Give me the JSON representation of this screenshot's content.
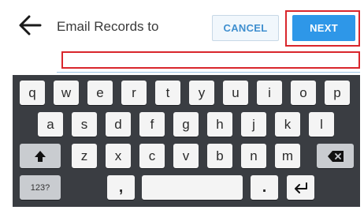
{
  "header": {
    "back_icon": "arrow-left-icon",
    "title": "Email Records to",
    "cancel_label": "CANCEL",
    "next_label": "NEXT"
  },
  "email_input": {
    "value": "",
    "placeholder": ""
  },
  "keyboard": {
    "row1": [
      "q",
      "w",
      "e",
      "r",
      "t",
      "y",
      "u",
      "i",
      "o",
      "p"
    ],
    "row2": [
      "a",
      "s",
      "d",
      "f",
      "g",
      "h",
      "j",
      "k",
      "l"
    ],
    "row3": [
      "z",
      "x",
      "c",
      "v",
      "b",
      "n",
      "m"
    ],
    "shift_icon": "shift-up-icon",
    "backspace_icon": "backspace-icon",
    "numbers_label": "123?",
    "comma_label": ",",
    "period_label": ".",
    "enter_icon": "enter-return-icon"
  },
  "colors": {
    "accent": "#2e97e8",
    "highlight": "#d9262c",
    "keyboard_bg": "#3a3d42"
  }
}
